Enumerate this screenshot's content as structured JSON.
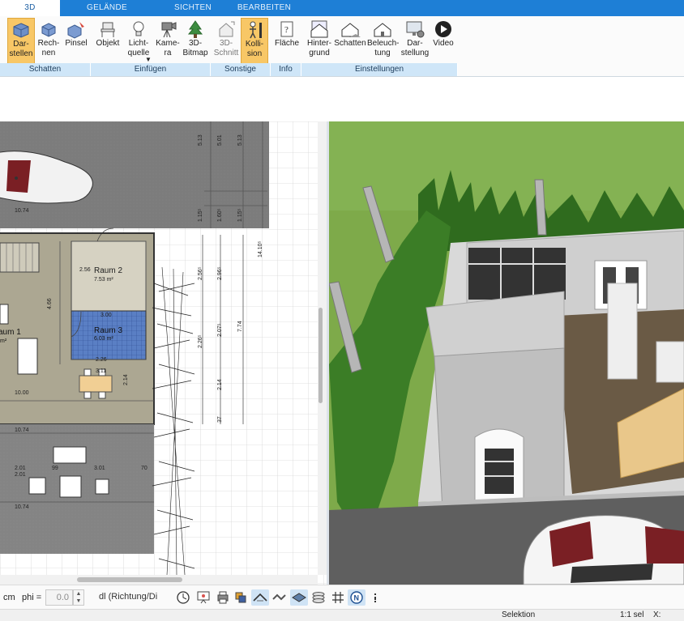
{
  "tabs": [
    {
      "label": "3D",
      "active": true
    },
    {
      "label": "GELÄNDE",
      "active": false
    },
    {
      "label": "SICHTEN",
      "active": false
    },
    {
      "label": "BEARBEITEN",
      "active": false
    }
  ],
  "ribbon": {
    "buttons": {
      "darstellen": "Dar-\nstellen",
      "rechnen": "Rech-\nnen",
      "pinsel": "Pinsel",
      "objekt": "Objekt",
      "lichtquelle": "Licht-\nquelle",
      "kamera": "Kame-\nra",
      "bitmap": "3D-\nBitmap",
      "schnitt": "3D-\nSchnitt",
      "kollision": "Kolli-\nsion",
      "flaeche": "Fläche",
      "hintergrund": "Hinter-\ngrund",
      "schatten": "Schatten",
      "beleuchtung": "Beleuch-\ntung",
      "darstellung": "Dar-\nstellung",
      "video": "Video"
    },
    "groups": {
      "schatten": "Schatten",
      "einfuegen": "Einfügen",
      "sonstige": "Sonstige",
      "info": "Info",
      "einstellungen": "Einstellungen"
    }
  },
  "plan": {
    "rooms": {
      "raum2_name": "Raum 2",
      "raum2_area": "7.53 m²",
      "raum3_name": "Raum 3",
      "raum3_area": "6.03 m²",
      "raum1_name": "aum 1",
      "raum1_area": "m²"
    },
    "dims": {
      "d1074a": "10.74",
      "d1000": "10.00",
      "d1074b": "10.74",
      "d1074c": "10.74",
      "d466": "4.66",
      "d256": "2.56",
      "d300": "3.00",
      "d311": "3.11",
      "d214": "2.14",
      "d226": "2.26",
      "d201a": "2.01",
      "d201b": "2.01",
      "d301": "3.01",
      "d99": "99",
      "d70": "70",
      "v513a": "5.13",
      "v501": "5.01",
      "v513b": "5.13",
      "v115a": "1.15⁵",
      "v160": "1.60⁵",
      "v115b": "1.15⁵",
      "v1410": "14.10⁵",
      "v256": "2.56⁵",
      "v296": "2.96⁵",
      "v774": "7.74",
      "v207": "2.07⁵",
      "v226": "2.26⁵",
      "v214": "2.14",
      "v37": "37"
    }
  },
  "toolbar": {
    "unit": "cm",
    "phi_label": "phi =",
    "phi_value": "0.0",
    "direction_select": "dl (Richtung/Di"
  },
  "status": {
    "mode": "Selektion",
    "selection": "1:1 sel",
    "x_label": "X:"
  }
}
